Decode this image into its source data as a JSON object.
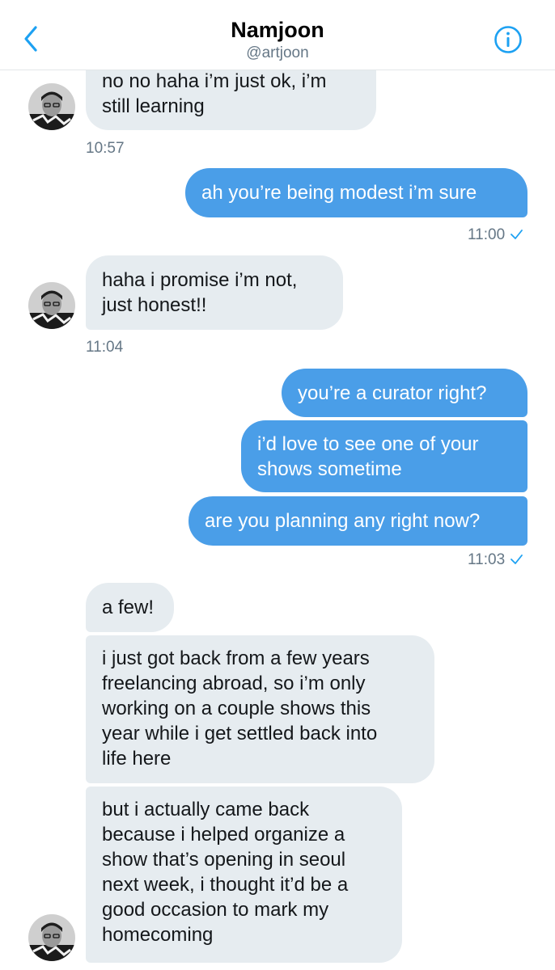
{
  "header": {
    "title": "Namjoon",
    "handle": "@artjoon"
  },
  "messages": [
    {
      "from": "them",
      "line1": "no no haha i’m just ok, i’m",
      "line2": "still learning"
    },
    {
      "from": "them",
      "time": "10:57"
    },
    {
      "from": "me",
      "text": "ah you’re being modest i’m sure",
      "time": "11:00"
    },
    {
      "from": "them",
      "line1": "haha i promise i’m not,",
      "line2": "just honest!!",
      "time": "11:04"
    },
    {
      "from": "me",
      "text": "you’re a curator right?"
    },
    {
      "from": "me",
      "line1": "i’d love to see one of your",
      "line2": "shows sometime"
    },
    {
      "from": "me",
      "text": "are you planning any right now?",
      "time": "11:03"
    },
    {
      "from": "them",
      "text": "a few!"
    },
    {
      "from": "them",
      "lines": [
        "i just got back from a few years",
        "freelancing abroad, so i’m only",
        "working on a couple shows this",
        "year while i get settled back into",
        "life here"
      ]
    },
    {
      "from": "them",
      "lines": [
        "but i actually came back",
        "because i helped organize a",
        "show that’s opening in seoul",
        "next week, i thought it’d be a",
        "good occasion to mark my",
        "homecoming"
      ]
    }
  ],
  "colors": {
    "accent": "#1da1f2",
    "outgoing_bubble": "#4a9ee8",
    "incoming_bubble": "#e6ecf0",
    "timestamp": "#657786"
  },
  "icons": {
    "back": "chevron-left-icon",
    "info": "info-icon",
    "read": "checkmark-icon"
  }
}
